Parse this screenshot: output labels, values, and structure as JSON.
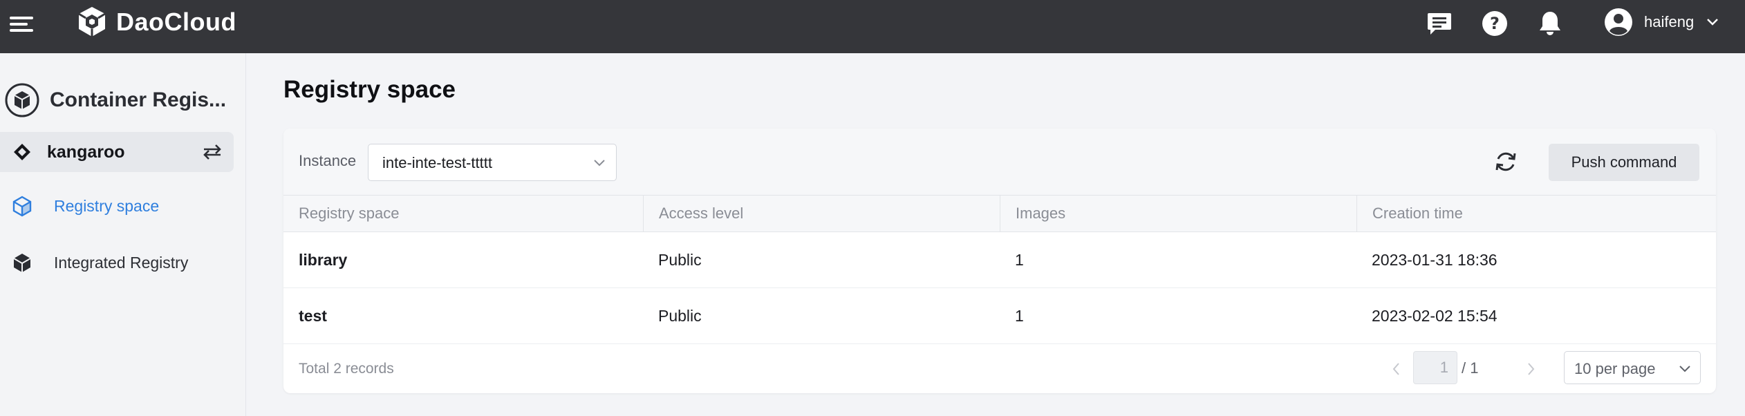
{
  "header": {
    "brand": "DaoCloud",
    "user": "haifeng",
    "icons": [
      "menu-icon",
      "daocloud-logo-icon",
      "message-icon",
      "help-icon",
      "bell-icon",
      "user-avatar-icon",
      "chevron-down-icon"
    ],
    "colors": {
      "bar": "#35363a",
      "text": "#ffffff"
    }
  },
  "sidebar": {
    "product": "Container Regis...",
    "workspace": "kangaroo",
    "items": [
      {
        "label": "Registry space",
        "icon": "cube-outline-icon",
        "active": true
      },
      {
        "label": "Integrated Registry",
        "icon": "cube-solid-icon",
        "active": false
      }
    ],
    "colors": {
      "active": "#2f7fde"
    }
  },
  "main": {
    "title": "Registry space",
    "toolbar": {
      "instance_label": "Instance",
      "instance_value": "inte-inte-test-ttttt",
      "push_label": "Push command"
    },
    "table": {
      "columns": [
        "Registry space",
        "Access level",
        "Images",
        "Creation time"
      ],
      "rows": [
        {
          "name": "library",
          "access": "Public",
          "images": "1",
          "created": "2023-01-31 18:36"
        },
        {
          "name": "test",
          "access": "Public",
          "images": "1",
          "created": "2023-02-02 15:54"
        }
      ]
    },
    "pagination": {
      "total": "Total 2 records",
      "current_page": "1",
      "total_pages": "/ 1",
      "per_page": "10 per page"
    }
  }
}
